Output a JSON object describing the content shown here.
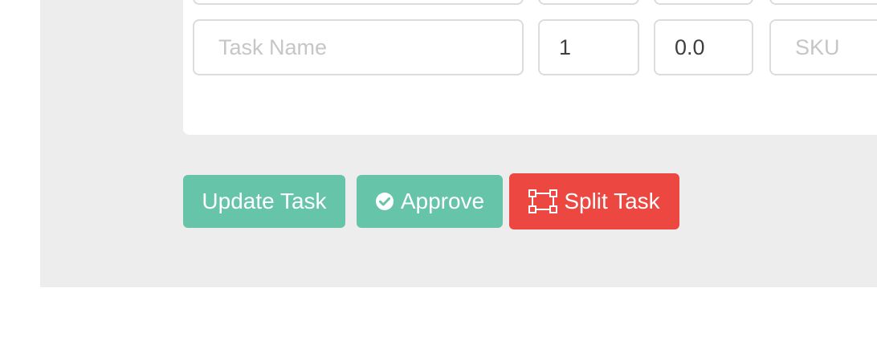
{
  "form": {
    "row": {
      "task_name_placeholder": "Task Name",
      "quantity_value": "1",
      "price_value": "0.0",
      "sku_placeholder": "SKU"
    }
  },
  "actions": {
    "update_label": "Update Task",
    "approve_label": "Approve",
    "approve_icon": "check-circle-icon",
    "split_label": "Split Task",
    "split_icon": "vector-square-icon"
  },
  "colors": {
    "page_background": "#ededed",
    "card_background": "#ffffff",
    "primary_button": "#66c4a9",
    "danger_button": "#ec4740",
    "input_border": "#dcdcdc",
    "placeholder_text": "#c6c6c6"
  }
}
